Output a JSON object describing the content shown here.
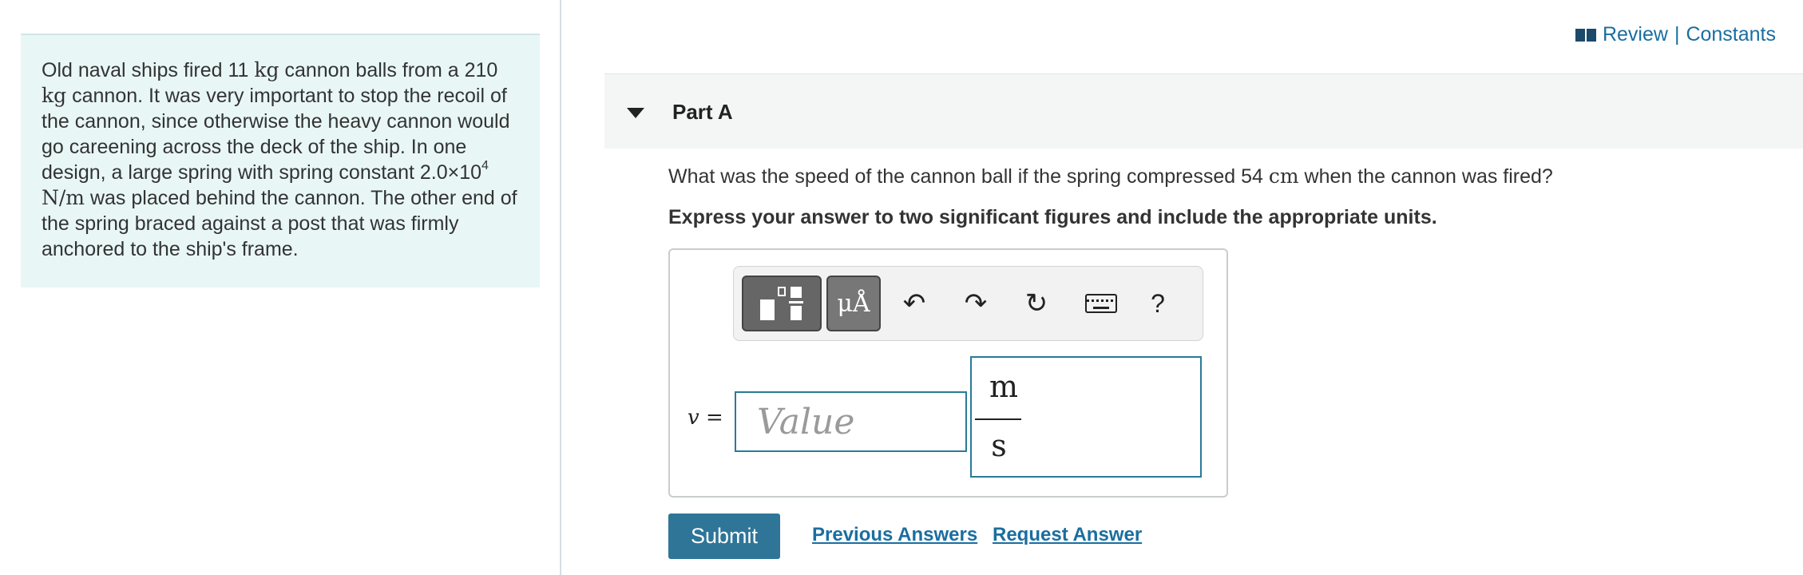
{
  "problem": {
    "t1": "Old naval ships fired 11 ",
    "u_kg": "kg",
    "t2": " cannon balls from a 210 ",
    "t3": " cannon. It was very important to stop the recoil of the cannon, since otherwise the heavy cannon would go careening across the deck of the ship. In one design, a large spring with spring constant 2.0×10",
    "exp": "4",
    "u_nm": "N/m",
    "t4": " was placed behind the cannon. The other end of the spring braced against a post that was firmly anchored to the ship's frame."
  },
  "header": {
    "review": "Review",
    "sep": "|",
    "constants": "Constants"
  },
  "part": {
    "title": "Part A"
  },
  "question": {
    "q1": "What was the speed of the cannon ball if the spring compressed 54 ",
    "q_unit": "cm",
    "q2": " when the cannon was fired?",
    "instruction": "Express your answer to two significant figures and include the appropriate units."
  },
  "toolbar": {
    "units_label": "μÅ",
    "undo": "↶",
    "redo": "↷",
    "reset": "↻",
    "help": "?"
  },
  "answer": {
    "variable": "v",
    "equals": " =",
    "placeholder": "Value",
    "unit_num": "m",
    "unit_den": "s"
  },
  "actions": {
    "submit": "Submit",
    "previous": "Previous Answers",
    "request": "Request Answer"
  }
}
